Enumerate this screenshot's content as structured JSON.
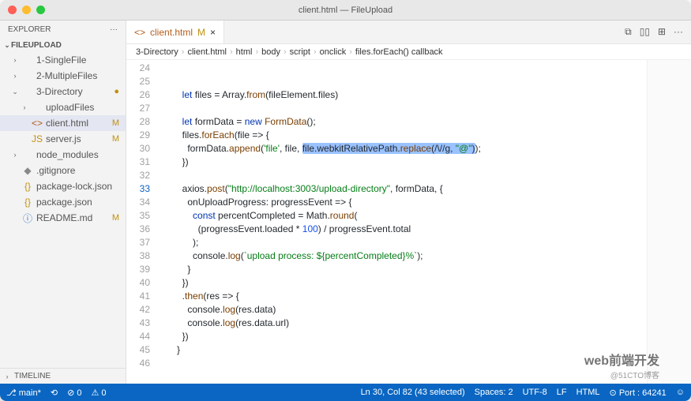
{
  "titlebar": {
    "title": "client.html — FileUpload"
  },
  "traffic": {
    "close": "#ff5f57",
    "min": "#febc2e",
    "max": "#28c840"
  },
  "sidebar": {
    "header": "EXPLORER",
    "section": "FILEUPLOAD",
    "timeline": "TIMELINE",
    "items": [
      {
        "chev": "›",
        "icon": "",
        "iconClass": "",
        "label": "1-SingleFile",
        "badge": "",
        "badgeClass": "",
        "sel": false,
        "indent": 0
      },
      {
        "chev": "›",
        "icon": "",
        "iconClass": "",
        "label": "2-MultipleFiles",
        "badge": "",
        "badgeClass": "",
        "sel": false,
        "indent": 0
      },
      {
        "chev": "⌄",
        "icon": "",
        "iconClass": "",
        "label": "3-Directory",
        "badge": "●",
        "badgeClass": "yellow",
        "sel": false,
        "indent": 0
      },
      {
        "chev": "›",
        "icon": "",
        "iconClass": "",
        "label": "uploadFiles",
        "badge": "",
        "badgeClass": "",
        "sel": false,
        "indent": 1
      },
      {
        "chev": "",
        "icon": "<>",
        "iconClass": "orange",
        "label": "client.html",
        "badge": "M",
        "badgeClass": "yellow",
        "sel": true,
        "indent": 1
      },
      {
        "chev": "",
        "icon": "JS",
        "iconClass": "yellow",
        "label": "server.js",
        "badge": "M",
        "badgeClass": "yellow",
        "sel": false,
        "indent": 1
      },
      {
        "chev": "›",
        "icon": "",
        "iconClass": "",
        "label": "node_modules",
        "badge": "",
        "badgeClass": "",
        "sel": false,
        "indent": 0
      },
      {
        "chev": "",
        "icon": "◆",
        "iconClass": "gray",
        "label": ".gitignore",
        "badge": "",
        "badgeClass": "",
        "sel": false,
        "indent": 0
      },
      {
        "chev": "",
        "icon": "{}",
        "iconClass": "yellow",
        "label": "package-lock.json",
        "badge": "",
        "badgeClass": "",
        "sel": false,
        "indent": 0
      },
      {
        "chev": "",
        "icon": "{}",
        "iconClass": "yellow",
        "label": "package.json",
        "badge": "",
        "badgeClass": "",
        "sel": false,
        "indent": 0
      },
      {
        "chev": "",
        "icon": "ⓘ",
        "iconClass": "blue",
        "label": "README.md",
        "badge": "M",
        "badgeClass": "yellow",
        "sel": false,
        "indent": 0
      }
    ]
  },
  "tab": {
    "icon": "<>",
    "name": "client.html",
    "status": "M"
  },
  "breadcrumbs": [
    "3-Directory",
    "client.html",
    "html",
    "body",
    "script",
    "onclick",
    "files.forEach() callback"
  ],
  "lines": {
    "start": 24,
    "end": 46,
    "highlight": 33,
    "code": [
      "",
      "",
      "        <span class='kw'>let</span> files = Array.<span class='fn'>from</span>(fileElement.files)",
      "",
      "        <span class='kw'>let</span> formData = <span class='kw'>new</span> <span class='fn'>FormData</span>();",
      "        files.<span class='fn'>forEach</span>(file =&gt; {",
      "          formData.<span class='fn'>append</span>(<span class='str'>'file'</span>, file, <span class='selbg'>file.webkitRelativePath.<span class='fn'>replace</span>(/\\//g, <span class='str'>\"@\"</span>)</span>);",
      "        })",
      "",
      "        axios.<span class='fn'>post</span>(<span class='str'>\"http://localhost:3003/upload-directory\"</span>, formData, {",
      "          onUploadProgress: progressEvent =&gt; {",
      "            <span class='kw'>const</span> percentCompleted = Math.<span class='fn'>round</span>(",
      "              (progressEvent.loaded * <span class='num'>100</span>) / progressEvent.total",
      "            );",
      "            console.<span class='fn'>log</span>(<span class='str'>`upload process: ${percentCompleted}%`</span>);",
      "          }",
      "        })",
      "        .<span class='fn'>then</span>(res =&gt; {",
      "          console.<span class='fn'>log</span>(res.data)",
      "          console.<span class='fn'>log</span>(res.data.url)",
      "        })",
      "      }",
      ""
    ]
  },
  "status": {
    "branch": "main*",
    "sync": "⟲",
    "errors": "⊘ 0",
    "warnings": "⚠ 0",
    "pos": "Ln 30, Col 82 (43 selected)",
    "spaces": "Spaces: 2",
    "encoding": "UTF-8",
    "eol": "LF",
    "lang": "HTML",
    "port": "⊙ Port : 64241",
    "feedback": "☺"
  },
  "watermark": {
    "main": "web前端开发",
    "sub": "@51CTO博客"
  }
}
